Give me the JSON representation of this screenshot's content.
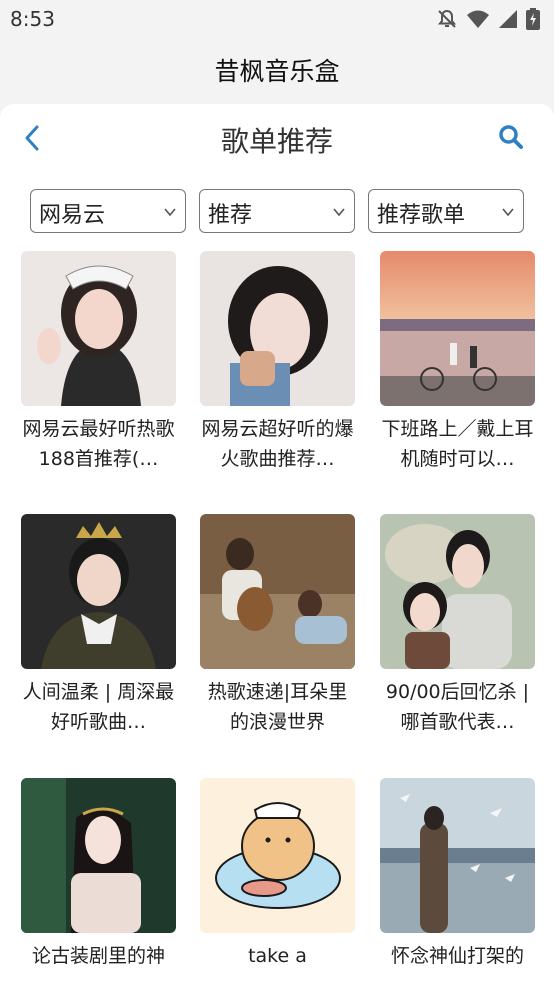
{
  "status": {
    "time": "8:53"
  },
  "app": {
    "title": "昔枫音乐盒"
  },
  "header": {
    "title": "歌单推荐"
  },
  "filters": [
    {
      "value": "网易云"
    },
    {
      "value": "推荐"
    },
    {
      "value": "推荐歌单"
    }
  ],
  "playlists": [
    {
      "title": "网易云最好听热歌188首推荐(…"
    },
    {
      "title": "网易云超好听的爆火歌曲推荐…"
    },
    {
      "title": "下班路上／戴上耳机随时可以…"
    },
    {
      "title": "人间温柔 | 周深最好听歌曲…"
    },
    {
      "title": "热歌速递|耳朵里的浪漫世界"
    },
    {
      "title": "90/00后回忆杀 | 哪首歌代表…"
    },
    {
      "title": "论古装剧里的神"
    },
    {
      "title": "take a"
    },
    {
      "title": "怀念神仙打架的"
    }
  ],
  "colors": {
    "accent": "#2f7fc4",
    "background": "#f3f3f3",
    "surface": "#ffffff"
  }
}
